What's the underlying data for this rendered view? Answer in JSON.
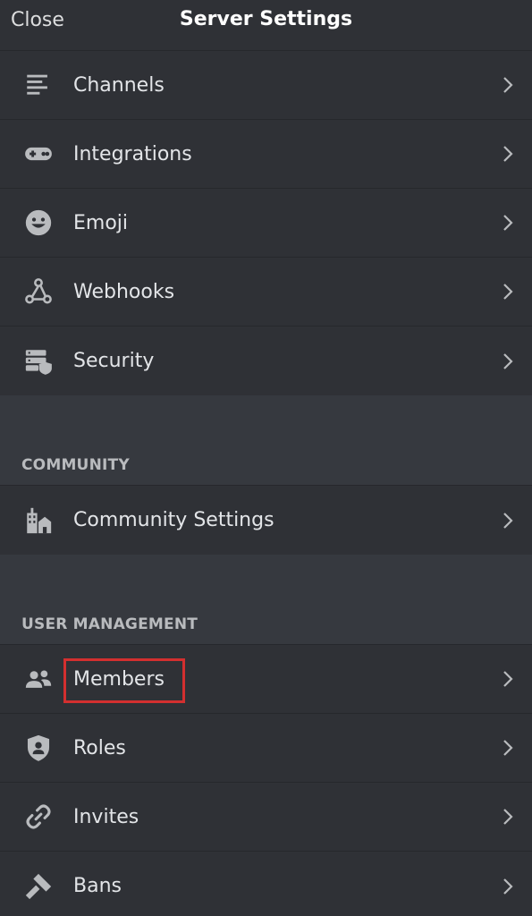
{
  "header": {
    "close_label": "Close",
    "title": "Server Settings"
  },
  "groups": {
    "main": [
      {
        "label": "Channels",
        "icon": "channels-icon"
      },
      {
        "label": "Integrations",
        "icon": "gamepad-icon"
      },
      {
        "label": "Emoji",
        "icon": "emoji-icon"
      },
      {
        "label": "Webhooks",
        "icon": "webhooks-icon"
      },
      {
        "label": "Security",
        "icon": "security-icon"
      }
    ],
    "community": {
      "header": "COMMUNITY",
      "items": [
        {
          "label": "Community Settings",
          "icon": "community-icon"
        }
      ]
    },
    "user_management": {
      "header": "USER MANAGEMENT",
      "items": [
        {
          "label": "Members",
          "icon": "members-icon"
        },
        {
          "label": "Roles",
          "icon": "shield-user-icon"
        },
        {
          "label": "Invites",
          "icon": "link-icon"
        },
        {
          "label": "Bans",
          "icon": "hammer-icon"
        }
      ]
    }
  },
  "colors": {
    "background": "#36393f",
    "panel": "#2f3136",
    "text": "#e3e5e8",
    "muted": "#b9bbbe",
    "highlight": "#d32f2f"
  }
}
